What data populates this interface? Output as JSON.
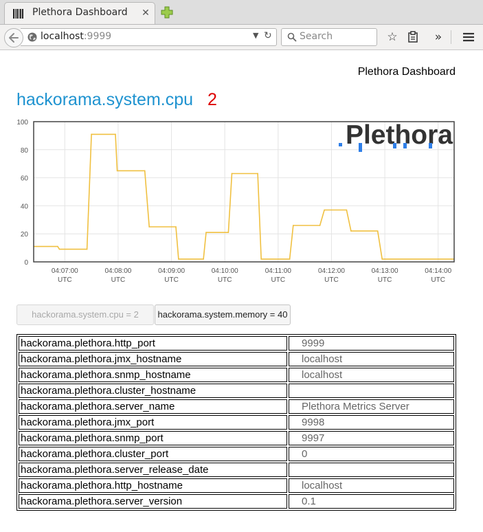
{
  "browser": {
    "tab_title": "Plethora Dashboard",
    "url_host": "localhost",
    "url_port": ":9999",
    "search_placeholder": "Search"
  },
  "page": {
    "header": "Plethora Dashboard",
    "metric_title": "hackorama.system.cpu",
    "metric_value": "2"
  },
  "chart_data": {
    "type": "line",
    "title": "",
    "xlabel": "",
    "ylabel": "",
    "ylim": [
      0,
      100
    ],
    "yticks": [
      0,
      20,
      40,
      60,
      80,
      100
    ],
    "xlim": [
      "04:06:25",
      "04:14:18"
    ],
    "x_tick_labels": [
      {
        "time": "04:07:00",
        "zone": "UTC"
      },
      {
        "time": "04:08:00",
        "zone": "UTC"
      },
      {
        "time": "04:09:00",
        "zone": "UTC"
      },
      {
        "time": "04:10:00",
        "zone": "UTC"
      },
      {
        "time": "04:11:00",
        "zone": "UTC"
      },
      {
        "time": "04:12:00",
        "zone": "UTC"
      },
      {
        "time": "04:13:00",
        "zone": "UTC"
      },
      {
        "time": "04:14:00",
        "zone": "UTC"
      }
    ],
    "grid": true,
    "watermark": "Plethora",
    "series": [
      {
        "color": "#f0c040",
        "points": [
          {
            "x": "04:06:25",
            "y": 11
          },
          {
            "x": "04:06:52",
            "y": 11
          },
          {
            "x": "04:06:54",
            "y": 9
          },
          {
            "x": "04:07:25",
            "y": 9
          },
          {
            "x": "04:07:30",
            "y": 91
          },
          {
            "x": "04:07:57",
            "y": 91
          },
          {
            "x": "04:07:59",
            "y": 65
          },
          {
            "x": "04:08:30",
            "y": 65
          },
          {
            "x": "04:08:35",
            "y": 25
          },
          {
            "x": "04:09:05",
            "y": 25
          },
          {
            "x": "04:09:08",
            "y": 2
          },
          {
            "x": "04:09:36",
            "y": 2
          },
          {
            "x": "04:09:39",
            "y": 21
          },
          {
            "x": "04:10:04",
            "y": 21
          },
          {
            "x": "04:10:08",
            "y": 63
          },
          {
            "x": "04:10:37",
            "y": 63
          },
          {
            "x": "04:10:41",
            "y": 2
          },
          {
            "x": "04:11:13",
            "y": 2
          },
          {
            "x": "04:11:17",
            "y": 26
          },
          {
            "x": "04:11:47",
            "y": 26
          },
          {
            "x": "04:11:52",
            "y": 37
          },
          {
            "x": "04:12:17",
            "y": 37
          },
          {
            "x": "04:12:22",
            "y": 22
          },
          {
            "x": "04:12:52",
            "y": 22
          },
          {
            "x": "04:12:57",
            "y": 2
          },
          {
            "x": "04:14:18",
            "y": 2
          }
        ]
      }
    ]
  },
  "metric_buttons": [
    {
      "label": "hackorama.system.cpu = 2",
      "state": "disabled"
    },
    {
      "label": "hackorama.system.memory = 40",
      "state": "active"
    }
  ],
  "properties": [
    {
      "key": "hackorama.plethora.http_port",
      "value": "9999"
    },
    {
      "key": "hackorama.plethora.jmx_hostname",
      "value": "localhost"
    },
    {
      "key": "hackorama.plethora.snmp_hostname",
      "value": "localhost"
    },
    {
      "key": "hackorama.plethora.cluster_hostname",
      "value": ""
    },
    {
      "key": "hackorama.plethora.server_name",
      "value": "Plethora Metrics Server"
    },
    {
      "key": "hackorama.plethora.jmx_port",
      "value": "9998"
    },
    {
      "key": "hackorama.plethora.snmp_port",
      "value": "9997"
    },
    {
      "key": "hackorama.plethora.cluster_port",
      "value": "0"
    },
    {
      "key": "hackorama.plethora.server_release_date",
      "value": ""
    },
    {
      "key": "hackorama.plethora.http_hostname",
      "value": "localhost"
    },
    {
      "key": "hackorama.plethora.server_version",
      "value": "0.1"
    }
  ]
}
